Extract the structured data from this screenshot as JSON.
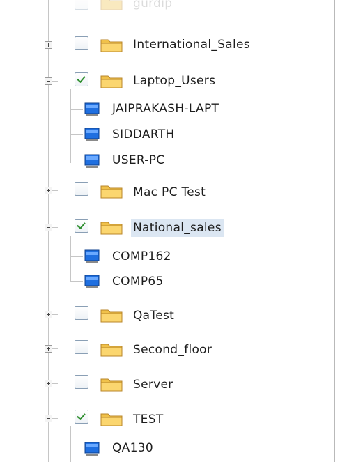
{
  "tree": {
    "top_partial_label": "gurdip",
    "nodes": [
      {
        "label": "International_Sales",
        "type": "folder",
        "expanded": false,
        "checked": false
      },
      {
        "label": "Laptop_Users",
        "type": "folder",
        "expanded": true,
        "checked": true,
        "children": [
          "JAIPRAKASH-LAPT",
          "SIDDARTH",
          "USER-PC"
        ]
      },
      {
        "label": "Mac PC Test",
        "type": "folder",
        "expanded": false,
        "checked": false
      },
      {
        "label": "National_sales",
        "type": "folder",
        "expanded": true,
        "checked": true,
        "selected": true,
        "children": [
          "COMP162",
          "COMP65"
        ]
      },
      {
        "label": "QaTest",
        "type": "folder",
        "expanded": false,
        "checked": false
      },
      {
        "label": "Second_floor",
        "type": "folder",
        "expanded": false,
        "checked": false
      },
      {
        "label": "Server",
        "type": "folder",
        "expanded": false,
        "checked": false
      },
      {
        "label": "TEST",
        "type": "folder",
        "expanded": true,
        "checked": true,
        "children": [
          "QA130"
        ]
      }
    ]
  },
  "colors": {
    "folder": "#f0c14a",
    "computer_screen": "#1f6fe0",
    "check": "#2f8f2f",
    "selection": "#dbe6f2"
  }
}
